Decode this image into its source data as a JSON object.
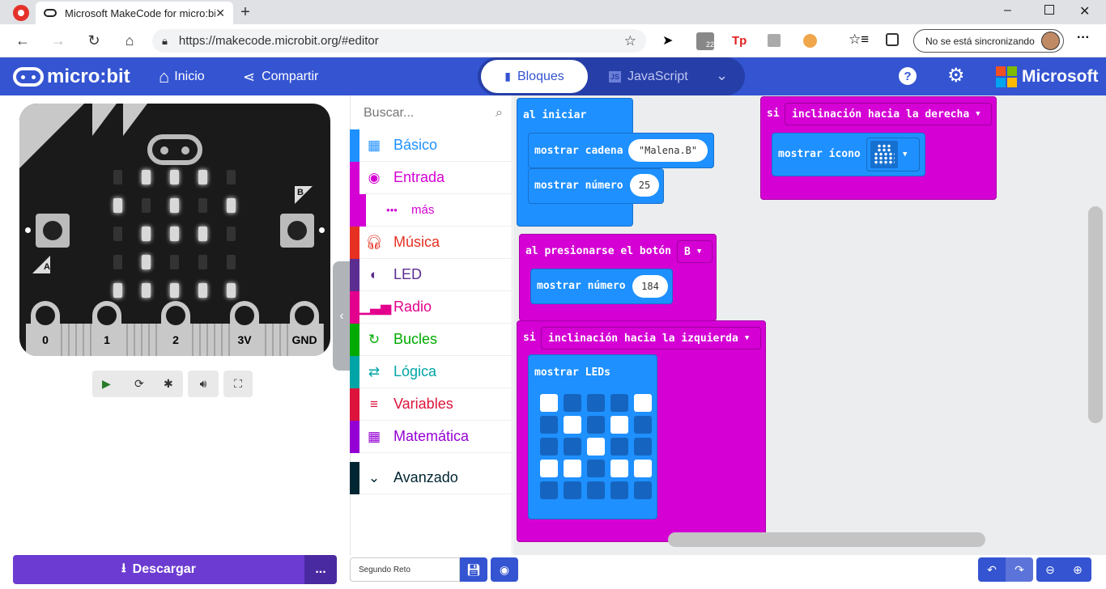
{
  "browser": {
    "tab_title": "Microsoft MakeCode for micro:bit",
    "url": "https://makecode.microbit.org/#editor",
    "sync_label": "No se está sincronizando",
    "ext_badge": "22",
    "ext_tp": "Tp"
  },
  "header": {
    "logo": "micro:bit",
    "home_label": "Inicio",
    "share_label": "Compartir",
    "blocks_label": "Bloques",
    "js_label": "JavaScript",
    "ms_label": "Microsoft",
    "accent": "#3454d1"
  },
  "simulator": {
    "pins": [
      "0",
      "1",
      "2",
      "3V",
      "GND"
    ],
    "button_a": "A",
    "button_b": "B",
    "leds_lit": [
      [
        1,
        0
      ],
      [
        2,
        0
      ],
      [
        3,
        0
      ],
      [
        0,
        1
      ],
      [
        2,
        1
      ],
      [
        4,
        1
      ],
      [
        1,
        2
      ],
      [
        2,
        2
      ],
      [
        3,
        2
      ],
      [
        1,
        3
      ],
      [
        0,
        4
      ],
      [
        1,
        4
      ],
      [
        2,
        4
      ],
      [
        3,
        4
      ],
      [
        4,
        4
      ]
    ]
  },
  "toolbox": {
    "search_placeholder": "Buscar...",
    "categories": [
      {
        "label": "Básico",
        "color": "#1e90ff",
        "icon": "grid-icon"
      },
      {
        "label": "Entrada",
        "color": "#d400d4",
        "icon": "target-icon"
      },
      {
        "label": "más",
        "color": "#d400d4",
        "icon": "dots-icon"
      },
      {
        "label": "Música",
        "color": "#e63022",
        "icon": "headphones-icon"
      },
      {
        "label": "LED",
        "color": "#5c2d91",
        "icon": "toggle-icon"
      },
      {
        "label": "Radio",
        "color": "#e3008c",
        "icon": "signal-icon"
      },
      {
        "label": "Bucles",
        "color": "#00aa00",
        "icon": "loop-icon"
      },
      {
        "label": "Lógica",
        "color": "#00a4a6",
        "icon": "shuffle-icon"
      },
      {
        "label": "Variables",
        "color": "#dc143c",
        "icon": "list-icon"
      },
      {
        "label": "Matemática",
        "color": "#9400d3",
        "icon": "calculator-icon"
      },
      {
        "label": "Avanzado",
        "color": "#002633",
        "icon": "chevron-down-icon"
      }
    ]
  },
  "blocks": {
    "on_start": "al iniciar",
    "show_string": "mostrar cadena",
    "string_value": "\"Malena.B\"",
    "show_number": "mostrar número",
    "number_value_1": "25",
    "on_button": "al presionarse el botón",
    "button_value": "B",
    "number_value_2": "184",
    "if_label": "si",
    "tilt_left": "inclinación hacia la izquierda",
    "show_leds": "mostrar LEDs",
    "tilt_right": "inclinación hacia la derecha",
    "show_icon": "mostrar ícono",
    "led_grid": [
      [
        1,
        0,
        0,
        0,
        1
      ],
      [
        0,
        1,
        0,
        1,
        0
      ],
      [
        0,
        0,
        1,
        0,
        0
      ],
      [
        1,
        1,
        0,
        1,
        1
      ],
      [
        0,
        0,
        0,
        0,
        0
      ]
    ],
    "colors": {
      "basic": "#1e90ff",
      "input": "#d400d4"
    }
  },
  "footer": {
    "download_label": "Descargar",
    "more_label": "...",
    "project_name": "Segundo Reto"
  }
}
